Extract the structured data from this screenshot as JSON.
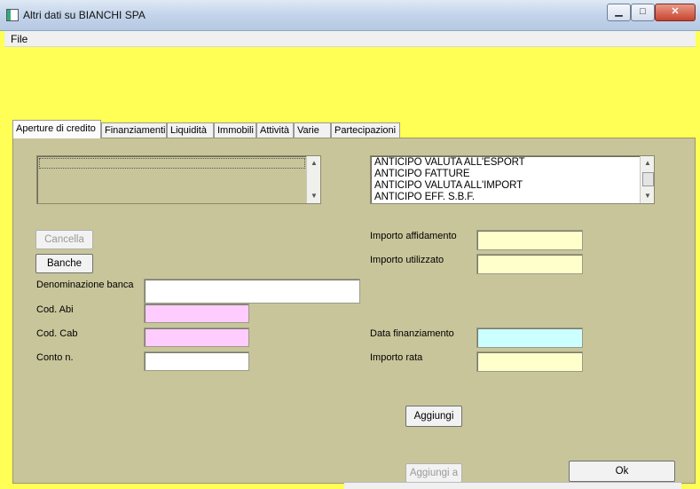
{
  "window": {
    "title": "Altri dati su BIANCHI SPA",
    "controls": {
      "minimize": "▁",
      "maximize": "□",
      "close": "✕"
    }
  },
  "menu": {
    "file": "File"
  },
  "tabs": [
    {
      "label": "Aperture di credito",
      "active": true
    },
    {
      "label": "Finanziamenti"
    },
    {
      "label": "Liquidità"
    },
    {
      "label": "Immobili"
    },
    {
      "label": "Attività"
    },
    {
      "label": "Varie"
    },
    {
      "label": "Partecipazioni"
    }
  ],
  "credit_types": {
    "items": [
      "ANTICIPO VALUTA ALL'ESPORT",
      "ANTICIPO FATTURE",
      "ANTICIPO VALUTA ALL'IMPORT",
      "ANTICIPO EFF. S.B.F."
    ]
  },
  "buttons": {
    "cancella": "Cancella",
    "banche": "Banche",
    "aggiungi": "Aggiungi",
    "aggiungi_a": "Aggiungi a",
    "ok": "Ok"
  },
  "fields": {
    "denominazione_banca": {
      "label": "Denominazione banca",
      "value": ""
    },
    "cod_abi": {
      "label": "Cod. Abi",
      "value": ""
    },
    "cod_cab": {
      "label": "Cod. Cab",
      "value": ""
    },
    "conto_n": {
      "label": "Conto n.",
      "value": ""
    },
    "importo_affidamento": {
      "label": "Importo affidamento",
      "value": ""
    },
    "importo_utilizzato": {
      "label": "Importo utilizzato",
      "value": ""
    },
    "data_finanziamento": {
      "label": "Data finanziamento",
      "value": ""
    },
    "importo_rata": {
      "label": "Importo rata",
      "value": ""
    }
  },
  "colors": {
    "header_band": "#ffff55",
    "panel": "#c8c59a",
    "pink_field": "#ffccff",
    "yellow_field": "#ffffcc",
    "cyan_field": "#ccffff"
  }
}
